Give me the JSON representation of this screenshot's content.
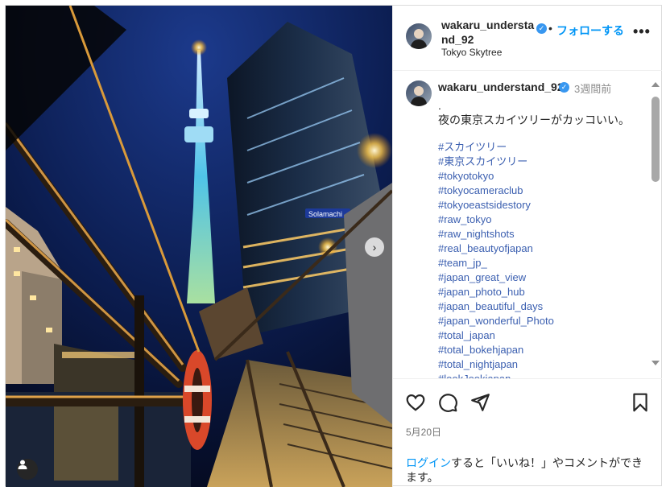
{
  "header": {
    "username": "wakaru_understand_92",
    "follow_label": "フォローする",
    "separator": "•",
    "location": "Tokyo Skytree",
    "more_glyph": "•••",
    "verified_glyph": "✓"
  },
  "caption": {
    "username": "wakaru_understand_92",
    "time": "3週間前",
    "lines": [
      ".",
      "夜の東京スカイツリーがカッコいい。"
    ],
    "hashtags": [
      "#スカイツリー",
      "#東京スカイツリー",
      "#tokyotokyo",
      "#tokyocameraclub",
      "#tokyoeastsidestory",
      "#raw_tokyo",
      "#raw_nightshots",
      "#real_beautyofjapan",
      "#team_jp_",
      "#japan_great_view",
      "#japan_photo_hub",
      "#japan_beautiful_days",
      "#japan_wonderful_Photo",
      "#total_japan",
      "#total_bokehjapan",
      "#total_nightjapan",
      "#lookJookjapan"
    ]
  },
  "media": {
    "next_glyph": "›",
    "sign_text": "Solamachi"
  },
  "actions": {
    "date": "5月20日",
    "login_link": "ログイン",
    "login_rest": "すると「いいね！」やコメントができます。"
  },
  "colors": {
    "accent": "#0095f6",
    "hashtag": "#3b5fb0",
    "verified": "#3897f0"
  },
  "icons": [
    "heart-icon",
    "comment-icon",
    "share-icon",
    "bookmark-icon",
    "user-tag-icon",
    "chevron-right-icon",
    "more-icon"
  ]
}
